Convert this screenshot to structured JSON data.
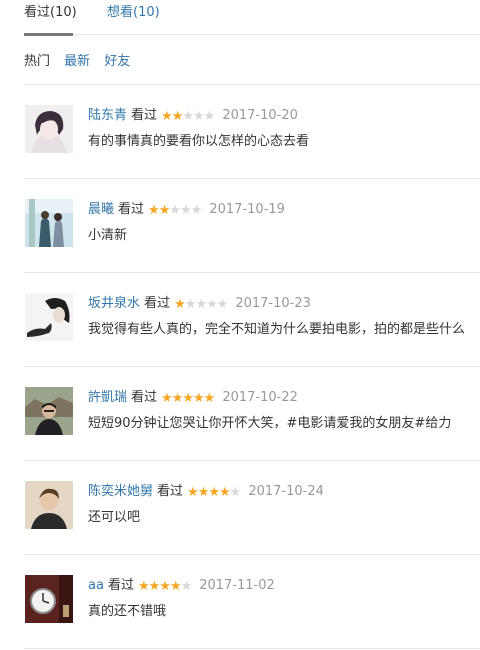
{
  "tabs": {
    "watched": "看过(10)",
    "want": "想看(10)"
  },
  "filters": [
    "热门",
    "最新",
    "好友"
  ],
  "reviews": [
    {
      "user": "陆东青",
      "status": "看过",
      "rating": 2,
      "date": "2017-10-20",
      "comment": "有的事情真的要看你以怎样的心态去看"
    },
    {
      "user": "晨曦",
      "status": "看过",
      "rating": 2,
      "date": "2017-10-19",
      "comment": "小清新"
    },
    {
      "user": "坂井泉水",
      "status": "看过",
      "rating": 1,
      "date": "2017-10-23",
      "comment": "我觉得有些人真的，完全不知道为什么要拍电影，拍的都是些什么"
    },
    {
      "user": "許凱瑞",
      "status": "看过",
      "rating": 5,
      "date": "2017-10-22",
      "comment": "短短90分钟让您哭让你开怀大笑，#电影请爱我的女朋友#给力"
    },
    {
      "user": "陈奕米她舅",
      "status": "看过",
      "rating": 4,
      "date": "2017-10-24",
      "comment": "还可以吧"
    },
    {
      "user": "aa",
      "status": "看过",
      "rating": 4,
      "date": "2017-11-02",
      "comment": "真的还不错哦"
    }
  ],
  "colors": {
    "link": "#3377aa",
    "star": "#f5a623",
    "star_off": "#d8d8d8",
    "date": "#999999"
  }
}
